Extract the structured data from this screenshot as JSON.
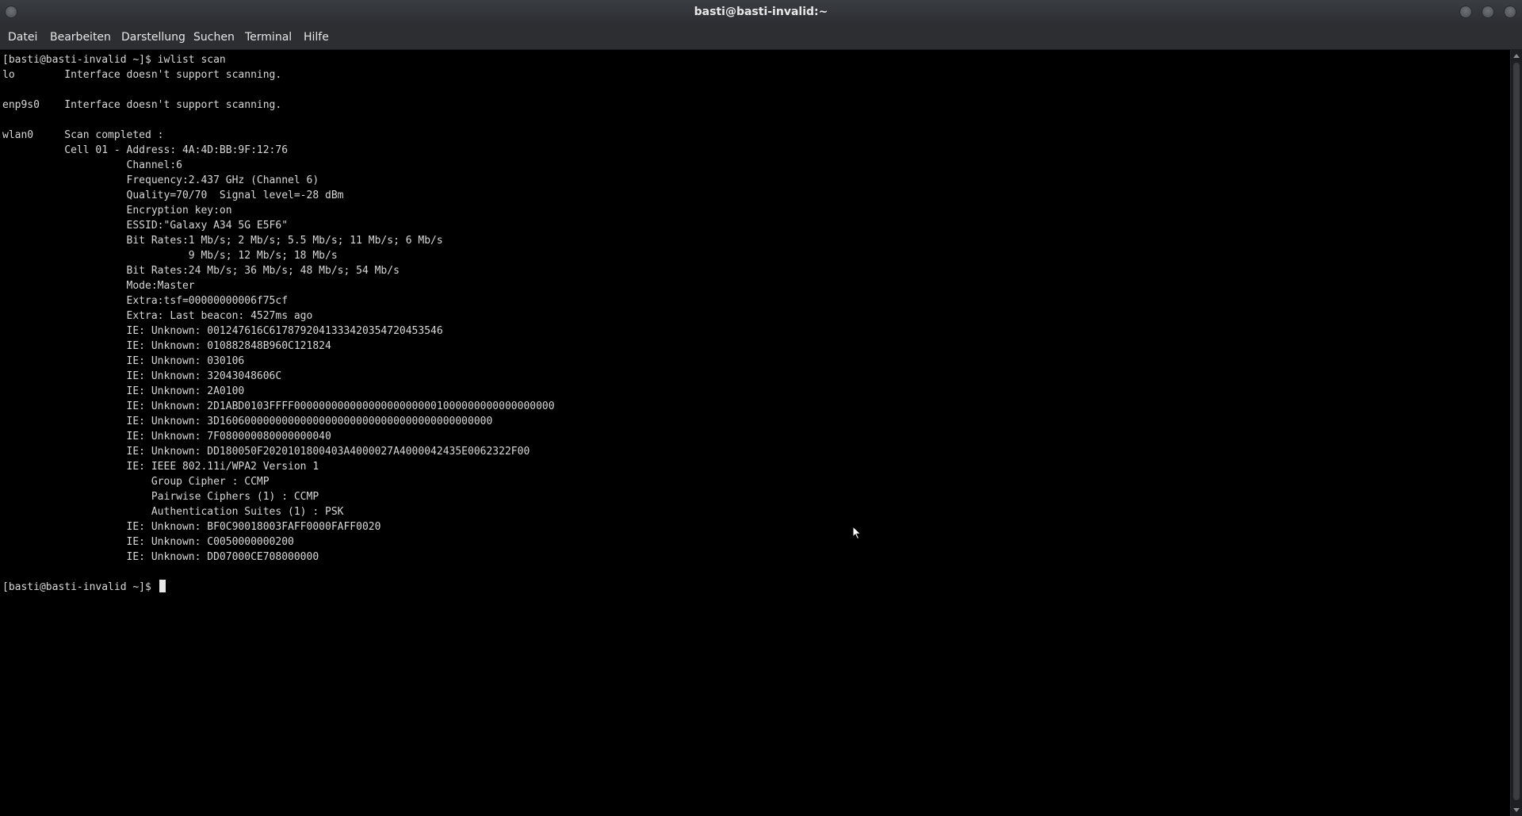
{
  "window": {
    "title": "basti@basti-invalid:~"
  },
  "menubar": {
    "items": [
      "Datei",
      "Bearbeiten",
      "Darstellung",
      "Suchen",
      "Terminal",
      "Hilfe"
    ]
  },
  "terminal": {
    "lines": [
      "[basti@basti-invalid ~]$ iwlist scan",
      "lo        Interface doesn't support scanning.",
      "",
      "enp9s0    Interface doesn't support scanning.",
      "",
      "wlan0     Scan completed :",
      "          Cell 01 - Address: 4A:4D:BB:9F:12:76",
      "                    Channel:6",
      "                    Frequency:2.437 GHz (Channel 6)",
      "                    Quality=70/70  Signal level=-28 dBm",
      "                    Encryption key:on",
      "                    ESSID:\"Galaxy A34 5G E5F6\"",
      "                    Bit Rates:1 Mb/s; 2 Mb/s; 5.5 Mb/s; 11 Mb/s; 6 Mb/s",
      "                              9 Mb/s; 12 Mb/s; 18 Mb/s",
      "                    Bit Rates:24 Mb/s; 36 Mb/s; 48 Mb/s; 54 Mb/s",
      "                    Mode:Master",
      "                    Extra:tsf=00000000006f75cf",
      "                    Extra: Last beacon: 4527ms ago",
      "                    IE: Unknown: 001247616C6178792041333420354720453546",
      "                    IE: Unknown: 010882848B960C121824",
      "                    IE: Unknown: 030106",
      "                    IE: Unknown: 32043048606C",
      "                    IE: Unknown: 2A0100",
      "                    IE: Unknown: 2D1ABD0103FFFF000000000000000000000001000000000000000000",
      "                    IE: Unknown: 3D16060000000000000000000000000000000000000000",
      "                    IE: Unknown: 7F080000080000000040",
      "                    IE: Unknown: DD180050F2020101800403A4000027A4000042435E0062322F00",
      "                    IE: IEEE 802.11i/WPA2 Version 1",
      "                        Group Cipher : CCMP",
      "                        Pairwise Ciphers (1) : CCMP",
      "                        Authentication Suites (1) : PSK",
      "                    IE: Unknown: BF0C90018003FAFF0000FAFF0020",
      "                    IE: Unknown: C0050000000200",
      "                    IE: Unknown: DD07000CE708000000"
    ],
    "prompt": "[basti@basti-invalid ~]$ "
  }
}
